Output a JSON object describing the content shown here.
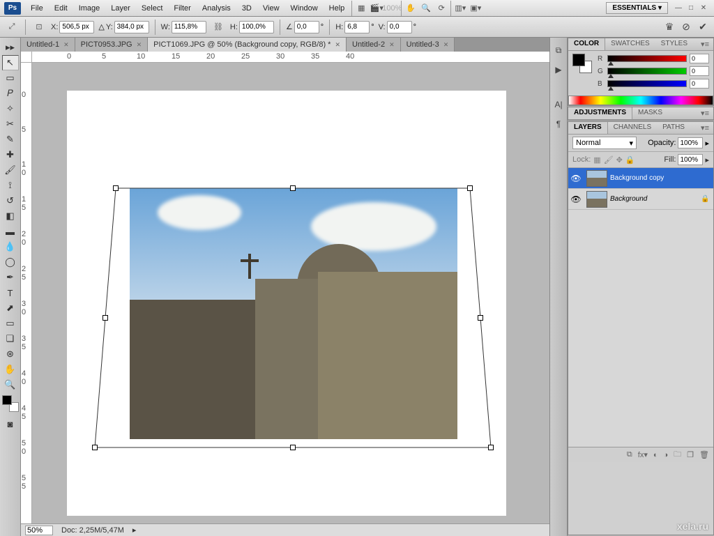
{
  "app": {
    "logo": "Ps",
    "workspace": "ESSENTIALS ▾"
  },
  "menu": [
    "File",
    "Edit",
    "Image",
    "Layer",
    "Select",
    "Filter",
    "Analysis",
    "3D",
    "View",
    "Window",
    "Help"
  ],
  "options": {
    "x_label": "X:",
    "x_val": "506,5 px",
    "y_label": "Y:",
    "y_val": "384,0 px",
    "w_label": "W:",
    "w_val": "115,8%",
    "h_label": "H:",
    "h_val": "100,0%",
    "a_label": "∠",
    "a_val": "0,0",
    "a_unit": "°",
    "sh_label": "H:",
    "sh_val": "6,8",
    "sh_unit": "°",
    "sv_label": "V:",
    "sv_val": "0,0",
    "sv_unit": "°",
    "zoom_menu": "100%"
  },
  "tabs": [
    {
      "label": "Untitled-1",
      "active": false
    },
    {
      "label": "PICT0953.JPG",
      "active": false
    },
    {
      "label": "PICT1069.JPG @ 50% (Background copy, RGB/8) *",
      "active": true
    },
    {
      "label": "Untitled-2",
      "active": false
    },
    {
      "label": "Untitled-3",
      "active": false
    }
  ],
  "status": {
    "zoom": "50%",
    "doc": "Doc: 2,25M/5,47M"
  },
  "panels": {
    "color": {
      "tabs": [
        "COLOR",
        "SWATCHES",
        "STYLES"
      ],
      "r": "0",
      "g": "0",
      "b": "0"
    },
    "adjustments": {
      "tabs": [
        "ADJUSTMENTS",
        "MASKS"
      ]
    },
    "layers": {
      "tabs": [
        "LAYERS",
        "CHANNELS",
        "PATHS"
      ],
      "blend": "Normal",
      "opacity_label": "Opacity:",
      "opacity": "100%",
      "lock_label": "Lock:",
      "fill_label": "Fill:",
      "fill": "100%",
      "items": [
        {
          "name": "Background copy",
          "selected": true,
          "locked": false,
          "italic": false
        },
        {
          "name": "Background",
          "selected": false,
          "locked": true,
          "italic": true
        }
      ]
    }
  },
  "watermark": "xela.ru"
}
